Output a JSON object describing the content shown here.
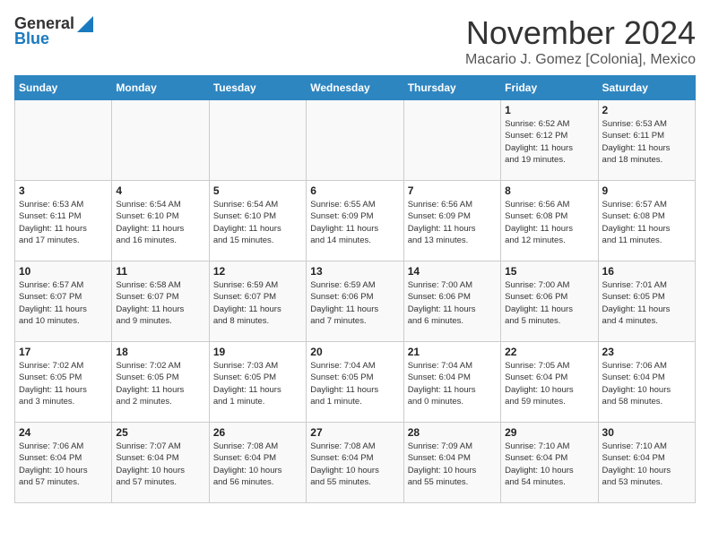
{
  "header": {
    "logo_general": "General",
    "logo_blue": "Blue",
    "month_title": "November 2024",
    "location": "Macario J. Gomez [Colonia], Mexico"
  },
  "weekdays": [
    "Sunday",
    "Monday",
    "Tuesday",
    "Wednesday",
    "Thursday",
    "Friday",
    "Saturday"
  ],
  "weeks": [
    [
      {
        "day": "",
        "info": ""
      },
      {
        "day": "",
        "info": ""
      },
      {
        "day": "",
        "info": ""
      },
      {
        "day": "",
        "info": ""
      },
      {
        "day": "",
        "info": ""
      },
      {
        "day": "1",
        "info": "Sunrise: 6:52 AM\nSunset: 6:12 PM\nDaylight: 11 hours\nand 19 minutes."
      },
      {
        "day": "2",
        "info": "Sunrise: 6:53 AM\nSunset: 6:11 PM\nDaylight: 11 hours\nand 18 minutes."
      }
    ],
    [
      {
        "day": "3",
        "info": "Sunrise: 6:53 AM\nSunset: 6:11 PM\nDaylight: 11 hours\nand 17 minutes."
      },
      {
        "day": "4",
        "info": "Sunrise: 6:54 AM\nSunset: 6:10 PM\nDaylight: 11 hours\nand 16 minutes."
      },
      {
        "day": "5",
        "info": "Sunrise: 6:54 AM\nSunset: 6:10 PM\nDaylight: 11 hours\nand 15 minutes."
      },
      {
        "day": "6",
        "info": "Sunrise: 6:55 AM\nSunset: 6:09 PM\nDaylight: 11 hours\nand 14 minutes."
      },
      {
        "day": "7",
        "info": "Sunrise: 6:56 AM\nSunset: 6:09 PM\nDaylight: 11 hours\nand 13 minutes."
      },
      {
        "day": "8",
        "info": "Sunrise: 6:56 AM\nSunset: 6:08 PM\nDaylight: 11 hours\nand 12 minutes."
      },
      {
        "day": "9",
        "info": "Sunrise: 6:57 AM\nSunset: 6:08 PM\nDaylight: 11 hours\nand 11 minutes."
      }
    ],
    [
      {
        "day": "10",
        "info": "Sunrise: 6:57 AM\nSunset: 6:07 PM\nDaylight: 11 hours\nand 10 minutes."
      },
      {
        "day": "11",
        "info": "Sunrise: 6:58 AM\nSunset: 6:07 PM\nDaylight: 11 hours\nand 9 minutes."
      },
      {
        "day": "12",
        "info": "Sunrise: 6:59 AM\nSunset: 6:07 PM\nDaylight: 11 hours\nand 8 minutes."
      },
      {
        "day": "13",
        "info": "Sunrise: 6:59 AM\nSunset: 6:06 PM\nDaylight: 11 hours\nand 7 minutes."
      },
      {
        "day": "14",
        "info": "Sunrise: 7:00 AM\nSunset: 6:06 PM\nDaylight: 11 hours\nand 6 minutes."
      },
      {
        "day": "15",
        "info": "Sunrise: 7:00 AM\nSunset: 6:06 PM\nDaylight: 11 hours\nand 5 minutes."
      },
      {
        "day": "16",
        "info": "Sunrise: 7:01 AM\nSunset: 6:05 PM\nDaylight: 11 hours\nand 4 minutes."
      }
    ],
    [
      {
        "day": "17",
        "info": "Sunrise: 7:02 AM\nSunset: 6:05 PM\nDaylight: 11 hours\nand 3 minutes."
      },
      {
        "day": "18",
        "info": "Sunrise: 7:02 AM\nSunset: 6:05 PM\nDaylight: 11 hours\nand 2 minutes."
      },
      {
        "day": "19",
        "info": "Sunrise: 7:03 AM\nSunset: 6:05 PM\nDaylight: 11 hours\nand 1 minute."
      },
      {
        "day": "20",
        "info": "Sunrise: 7:04 AM\nSunset: 6:05 PM\nDaylight: 11 hours\nand 1 minute."
      },
      {
        "day": "21",
        "info": "Sunrise: 7:04 AM\nSunset: 6:04 PM\nDaylight: 11 hours\nand 0 minutes."
      },
      {
        "day": "22",
        "info": "Sunrise: 7:05 AM\nSunset: 6:04 PM\nDaylight: 10 hours\nand 59 minutes."
      },
      {
        "day": "23",
        "info": "Sunrise: 7:06 AM\nSunset: 6:04 PM\nDaylight: 10 hours\nand 58 minutes."
      }
    ],
    [
      {
        "day": "24",
        "info": "Sunrise: 7:06 AM\nSunset: 6:04 PM\nDaylight: 10 hours\nand 57 minutes."
      },
      {
        "day": "25",
        "info": "Sunrise: 7:07 AM\nSunset: 6:04 PM\nDaylight: 10 hours\nand 57 minutes."
      },
      {
        "day": "26",
        "info": "Sunrise: 7:08 AM\nSunset: 6:04 PM\nDaylight: 10 hours\nand 56 minutes."
      },
      {
        "day": "27",
        "info": "Sunrise: 7:08 AM\nSunset: 6:04 PM\nDaylight: 10 hours\nand 55 minutes."
      },
      {
        "day": "28",
        "info": "Sunrise: 7:09 AM\nSunset: 6:04 PM\nDaylight: 10 hours\nand 55 minutes."
      },
      {
        "day": "29",
        "info": "Sunrise: 7:10 AM\nSunset: 6:04 PM\nDaylight: 10 hours\nand 54 minutes."
      },
      {
        "day": "30",
        "info": "Sunrise: 7:10 AM\nSunset: 6:04 PM\nDaylight: 10 hours\nand 53 minutes."
      }
    ]
  ]
}
